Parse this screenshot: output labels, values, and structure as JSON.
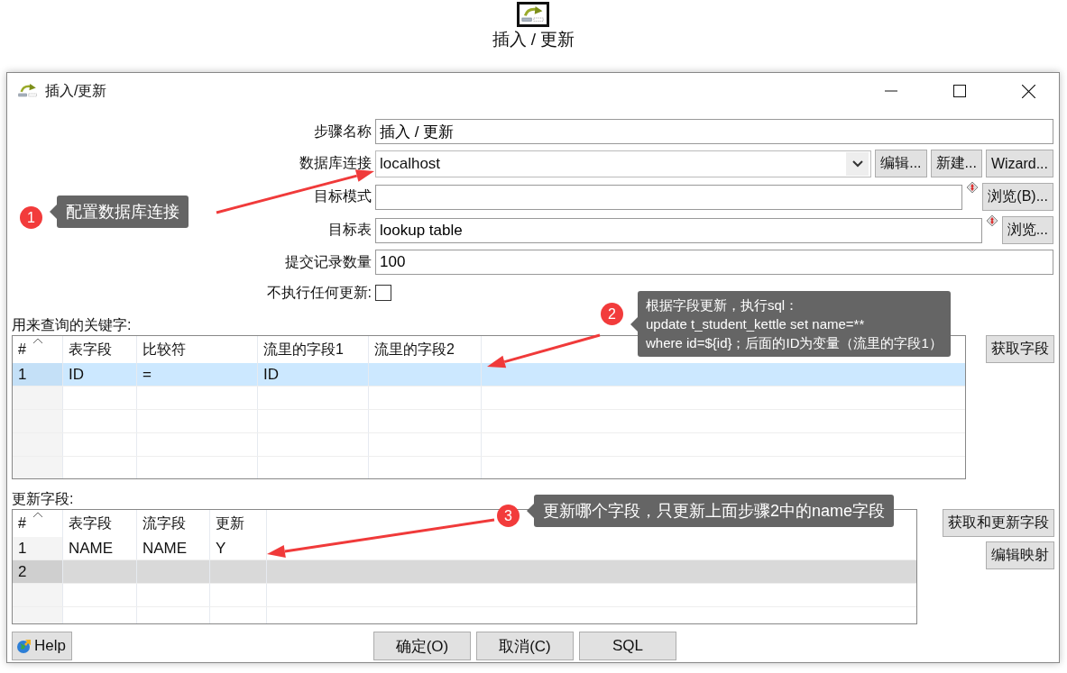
{
  "step_icon": {
    "label": "插入 / 更新"
  },
  "window": {
    "title": "插入/更新"
  },
  "form": [
    {
      "label": "步骤名称",
      "kind": "text",
      "value": "插入 / 更新"
    },
    {
      "label": "数据库连接",
      "kind": "combo",
      "value": "localhost",
      "buttons": [
        "编辑...",
        "新建...",
        "Wizard..."
      ]
    },
    {
      "label": "目标模式",
      "kind": "text",
      "variable": true,
      "buttons": [
        "浏览(B)..."
      ]
    },
    {
      "label": "目标表",
      "kind": "text",
      "variable": true,
      "value": "lookup table",
      "buttons": [
        "浏览..."
      ]
    },
    {
      "label": "提交记录数量",
      "kind": "text",
      "value": "100"
    },
    {
      "label": "不执行任何更新:",
      "kind": "checkbox",
      "checked": false
    }
  ],
  "key_table": {
    "label": "用来查询的关键字:",
    "focused": true,
    "columns": [
      "#",
      "表字段",
      "比较符",
      "流里的字段1",
      "流里的字段2"
    ],
    "rows": [
      {
        "cells": [
          "1",
          "ID",
          "=",
          "ID"
        ],
        "selected": true
      }
    ],
    "buttons": [
      "获取字段"
    ]
  },
  "update_table": {
    "label": "更新字段:",
    "focused": false,
    "columns": [
      "#",
      "表字段",
      "流字段",
      "更新"
    ],
    "rows": [
      {
        "cells": [
          "1",
          "NAME",
          "NAME",
          "Y"
        ],
        "selected": false
      },
      {
        "cells": [
          "2"
        ],
        "selected": true
      }
    ],
    "buttons": [
      "获取和更新字段",
      "编辑映射"
    ]
  },
  "footer": {
    "help": "Help",
    "buttons": [
      "确定(O)",
      "取消(C)",
      "SQL"
    ]
  },
  "annotations": [
    {
      "number": "1",
      "text": "配置数据库连接"
    },
    {
      "number": "2",
      "text": "根据字段更新，执行sql：\nupdate t_student_kettle set name=**\nwhere id=${id}；后面的ID为变量（流里的字段1）"
    },
    {
      "number": "3",
      "text": "更新哪个字段，只更新上面步骤2中的name字段"
    }
  ]
}
